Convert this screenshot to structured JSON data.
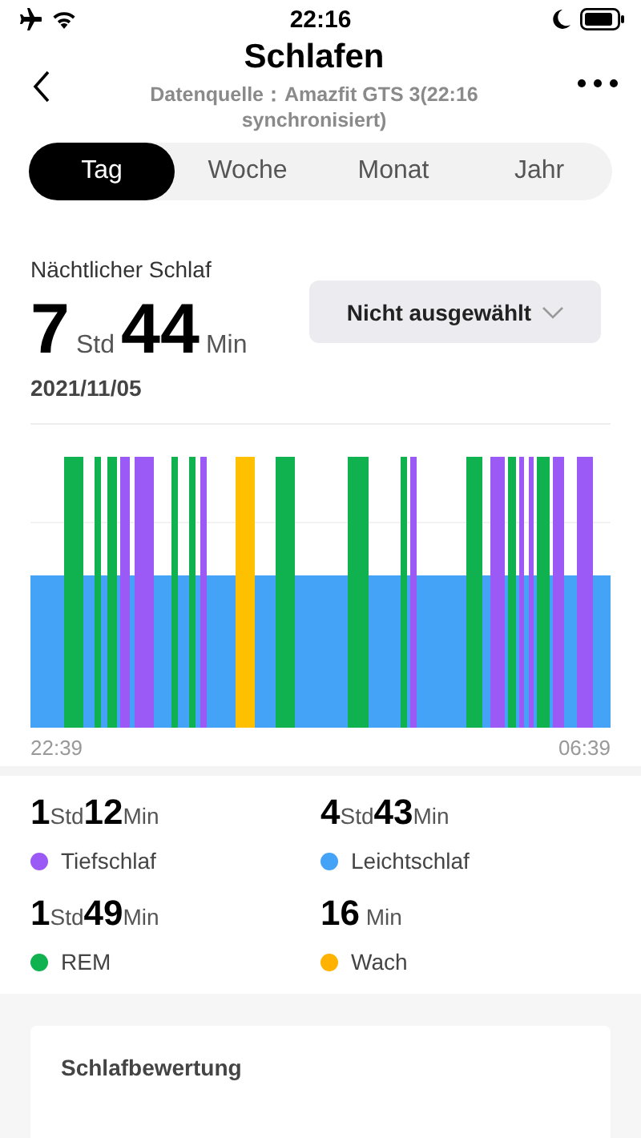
{
  "status_bar": {
    "time": "22:16"
  },
  "header": {
    "title": "Schlafen",
    "subtitle": "Datenquelle：Amazfit GTS 3(22:16 synchronisiert)"
  },
  "tabs": [
    {
      "label": "Tag",
      "selected": true
    },
    {
      "label": "Woche",
      "selected": false
    },
    {
      "label": "Monat",
      "selected": false
    },
    {
      "label": "Jahr",
      "selected": false
    }
  ],
  "summary": {
    "label": "Nächtlicher Schlaf",
    "total": [
      {
        "kind": "number",
        "text": "7"
      },
      {
        "kind": "unit",
        "text": "Std"
      },
      {
        "kind": "number",
        "text": "44"
      },
      {
        "kind": "unit",
        "text": "Min"
      }
    ],
    "date": "2021/11/05",
    "dropdown": "Nicht ausgewählt"
  },
  "chart": {
    "start": "22:39",
    "end": "06:39"
  },
  "stats": [
    {
      "label": "Tiefschlaf",
      "color": "#9b59f5",
      "value": [
        {
          "kind": "number",
          "text": "1"
        },
        {
          "kind": "unit",
          "text": "Std"
        },
        {
          "kind": "number",
          "text": "12"
        },
        {
          "kind": "unit",
          "text": "Min"
        }
      ]
    },
    {
      "label": "Leichtschlaf",
      "color": "#44a3f7",
      "value": [
        {
          "kind": "number",
          "text": "4"
        },
        {
          "kind": "unit",
          "text": "Std"
        },
        {
          "kind": "number",
          "text": "43"
        },
        {
          "kind": "unit",
          "text": "Min"
        }
      ]
    },
    {
      "label": "REM",
      "color": "#0fb24f",
      "value": [
        {
          "kind": "number",
          "text": "1"
        },
        {
          "kind": "unit",
          "text": "Std"
        },
        {
          "kind": "number",
          "text": "49"
        },
        {
          "kind": "unit",
          "text": "Min"
        }
      ]
    },
    {
      "label": "Wach",
      "color": "#ffb300",
      "value": [
        {
          "kind": "number",
          "text": "16"
        },
        {
          "kind": "unit",
          "text": " Min"
        }
      ]
    }
  ],
  "rating_card": {
    "title": "Schlafbewertung"
  }
}
